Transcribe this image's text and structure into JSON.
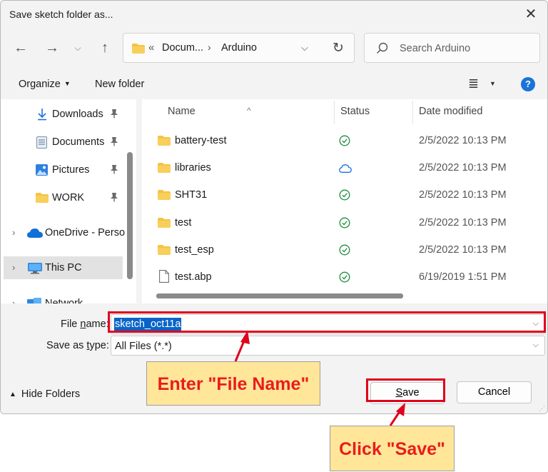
{
  "window": {
    "title": "Save sketch folder as...",
    "close_glyph": "✕"
  },
  "nav": {
    "back": "←",
    "forward": "→",
    "recent": "⌵",
    "up": "↑"
  },
  "address": {
    "overflow": "«",
    "segments": [
      "Docum...",
      "Arduino"
    ],
    "separator": "›",
    "dropdown": "⌵",
    "refresh": "↻"
  },
  "search": {
    "placeholder": "Search Arduino"
  },
  "toolbar": {
    "organize": "Organize",
    "organize_arrow": "▼",
    "new_folder": "New folder",
    "view_glyph": "≣",
    "view_arrow": "▼",
    "help_glyph": "?"
  },
  "sidebar": {
    "items": [
      {
        "label": "Downloads",
        "icon": "download-icon",
        "pinned": true
      },
      {
        "label": "Documents",
        "icon": "document-icon",
        "pinned": true
      },
      {
        "label": "Pictures",
        "icon": "picture-icon",
        "pinned": true
      },
      {
        "label": "WORK",
        "icon": "folder-icon",
        "pinned": true
      },
      {
        "label": "OneDrive - Perso",
        "icon": "cloud-icon",
        "expandable": true
      },
      {
        "label": "This PC",
        "icon": "monitor-icon",
        "expandable": true,
        "selected": true
      },
      {
        "label": "Network",
        "icon": "network-icon",
        "expandable": true
      }
    ],
    "pin_glyph": "📌",
    "expand_glyph": "›"
  },
  "files": {
    "columns": {
      "name": "Name",
      "status": "Status",
      "date": "Date modified"
    },
    "sort_glyph": "^",
    "rows": [
      {
        "name": "battery-test",
        "type": "folder",
        "status": "synced",
        "date": "2/5/2022 10:13 PM"
      },
      {
        "name": "libraries",
        "type": "folder",
        "status": "cloud",
        "date": "2/5/2022 10:13 PM"
      },
      {
        "name": "SHT31",
        "type": "folder",
        "status": "synced",
        "date": "2/5/2022 10:13 PM"
      },
      {
        "name": "test",
        "type": "folder",
        "status": "synced",
        "date": "2/5/2022 10:13 PM"
      },
      {
        "name": "test_esp",
        "type": "folder",
        "status": "synced",
        "date": "2/5/2022 10:13 PM"
      },
      {
        "name": "test.abp",
        "type": "file",
        "status": "synced",
        "date": "6/19/2019 1:51 PM"
      }
    ]
  },
  "form": {
    "file_name_label": "File name:",
    "file_name_value": "sketch_oct11a",
    "save_type_label": "Save as type:",
    "save_type_value": "All Files (*.*)",
    "dropdown_glyph": "⌵"
  },
  "footer": {
    "hide_folders": "Hide Folders",
    "hide_caret": "▲",
    "save": "Save",
    "cancel": "Cancel"
  },
  "annotations": {
    "enter_file_name": "Enter \"File Name\"",
    "click_save": "Click \"Save\"",
    "highlight_color": "#e0001b",
    "callout_bg": "#ffe699",
    "callout_text_color": "#ea1c1c"
  },
  "colors": {
    "folder": "#f5c343",
    "accent": "#0a64c8",
    "status_ok": "#1e8e3e",
    "status_cloud": "#1a73d9"
  }
}
